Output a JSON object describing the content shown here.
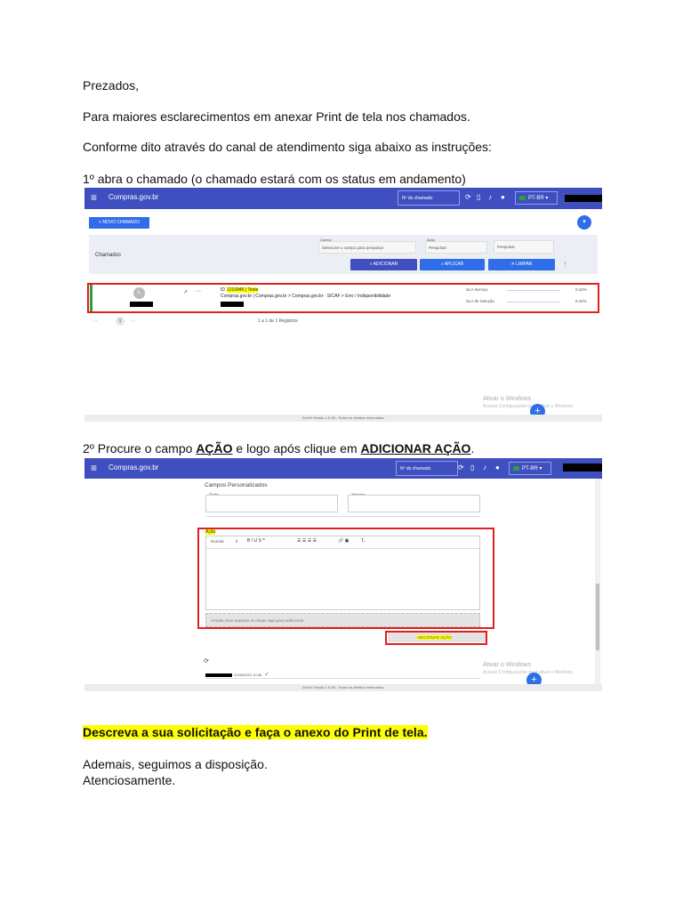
{
  "letter": {
    "greeting": "Prezados,",
    "intro": "Para maiores esclarecimentos em anexar Print de tela nos chamados.",
    "instruction": "Conforme dito através do canal de atendimento siga abaixo as instruções:",
    "step1": "1º abra o chamado (o chamado estará com os status em andamento)",
    "step2_prefix": "2º Procure o campo ",
    "step2_field": "AÇÃO",
    "step2_middle": " e logo após clique em ",
    "step2_action": "ADICIONAR AÇÃO",
    "step2_suffix": ".",
    "highlight_note": "Descreva a sua solicitação e faça o anexo do Print de tela.",
    "closing1": "Ademais, seguimos a disposição.",
    "closing2": "Atenciosamente."
  },
  "app": {
    "brand": "Compras.gov.br",
    "ticket_search_placeholder": "Nº do chamado",
    "language": "PT-BR",
    "footer": "GovSr Versão 1.5.96 - Todos os direitos reservados.",
    "watermark_title": "Ativar o Windows",
    "watermark_sub": "Acesse Configurações para ativar o Windows.",
    "colors": {
      "header": "#3f4fbf",
      "primary_button": "#2f6ee8",
      "highlight_box": "#e02020"
    }
  },
  "shot1": {
    "new_ticket_button": "NOVO CHAMADO",
    "section_title": "Chamados",
    "filter_field_label": "Campo",
    "filter_field_value": "Selecione o campo para pesquisar",
    "filter_action_label": "Ação",
    "filter_action_value": "Pesquisar",
    "filter_search_placeholder": "Pesquisar",
    "add_button": "ADICIONAR",
    "apply_button": "APLICAR",
    "clear_button": "LIMPAR",
    "ticket_id_prefix": "ID",
    "ticket_id": "1210945 | Teste",
    "ticket_path": "Compras.gov.br | Compras.gov.br > Compras.gov.br - SICAF > Erro / Indisponibilidade",
    "sla_service_label": "SLA Serviço",
    "sla_service_value": "0.42%",
    "sla_solution_label": "SLA de Solução",
    "sla_solution_value": "0.42%",
    "pagination": "1 a 1 de 1 Registros",
    "current_page": "1"
  },
  "shot2": {
    "custom_fields_title": "Campos Personalizados",
    "field1_label": "Órgão",
    "field2_label": "Telefone",
    "action_label": "Ação",
    "editor_format": "Normal",
    "attach_placeholder": "Arraste seus arquivos ou clique aqui para selecionar",
    "add_action_button": "ADICIONAR AÇÃO",
    "timestamp": "22/05/2023 10:46"
  }
}
